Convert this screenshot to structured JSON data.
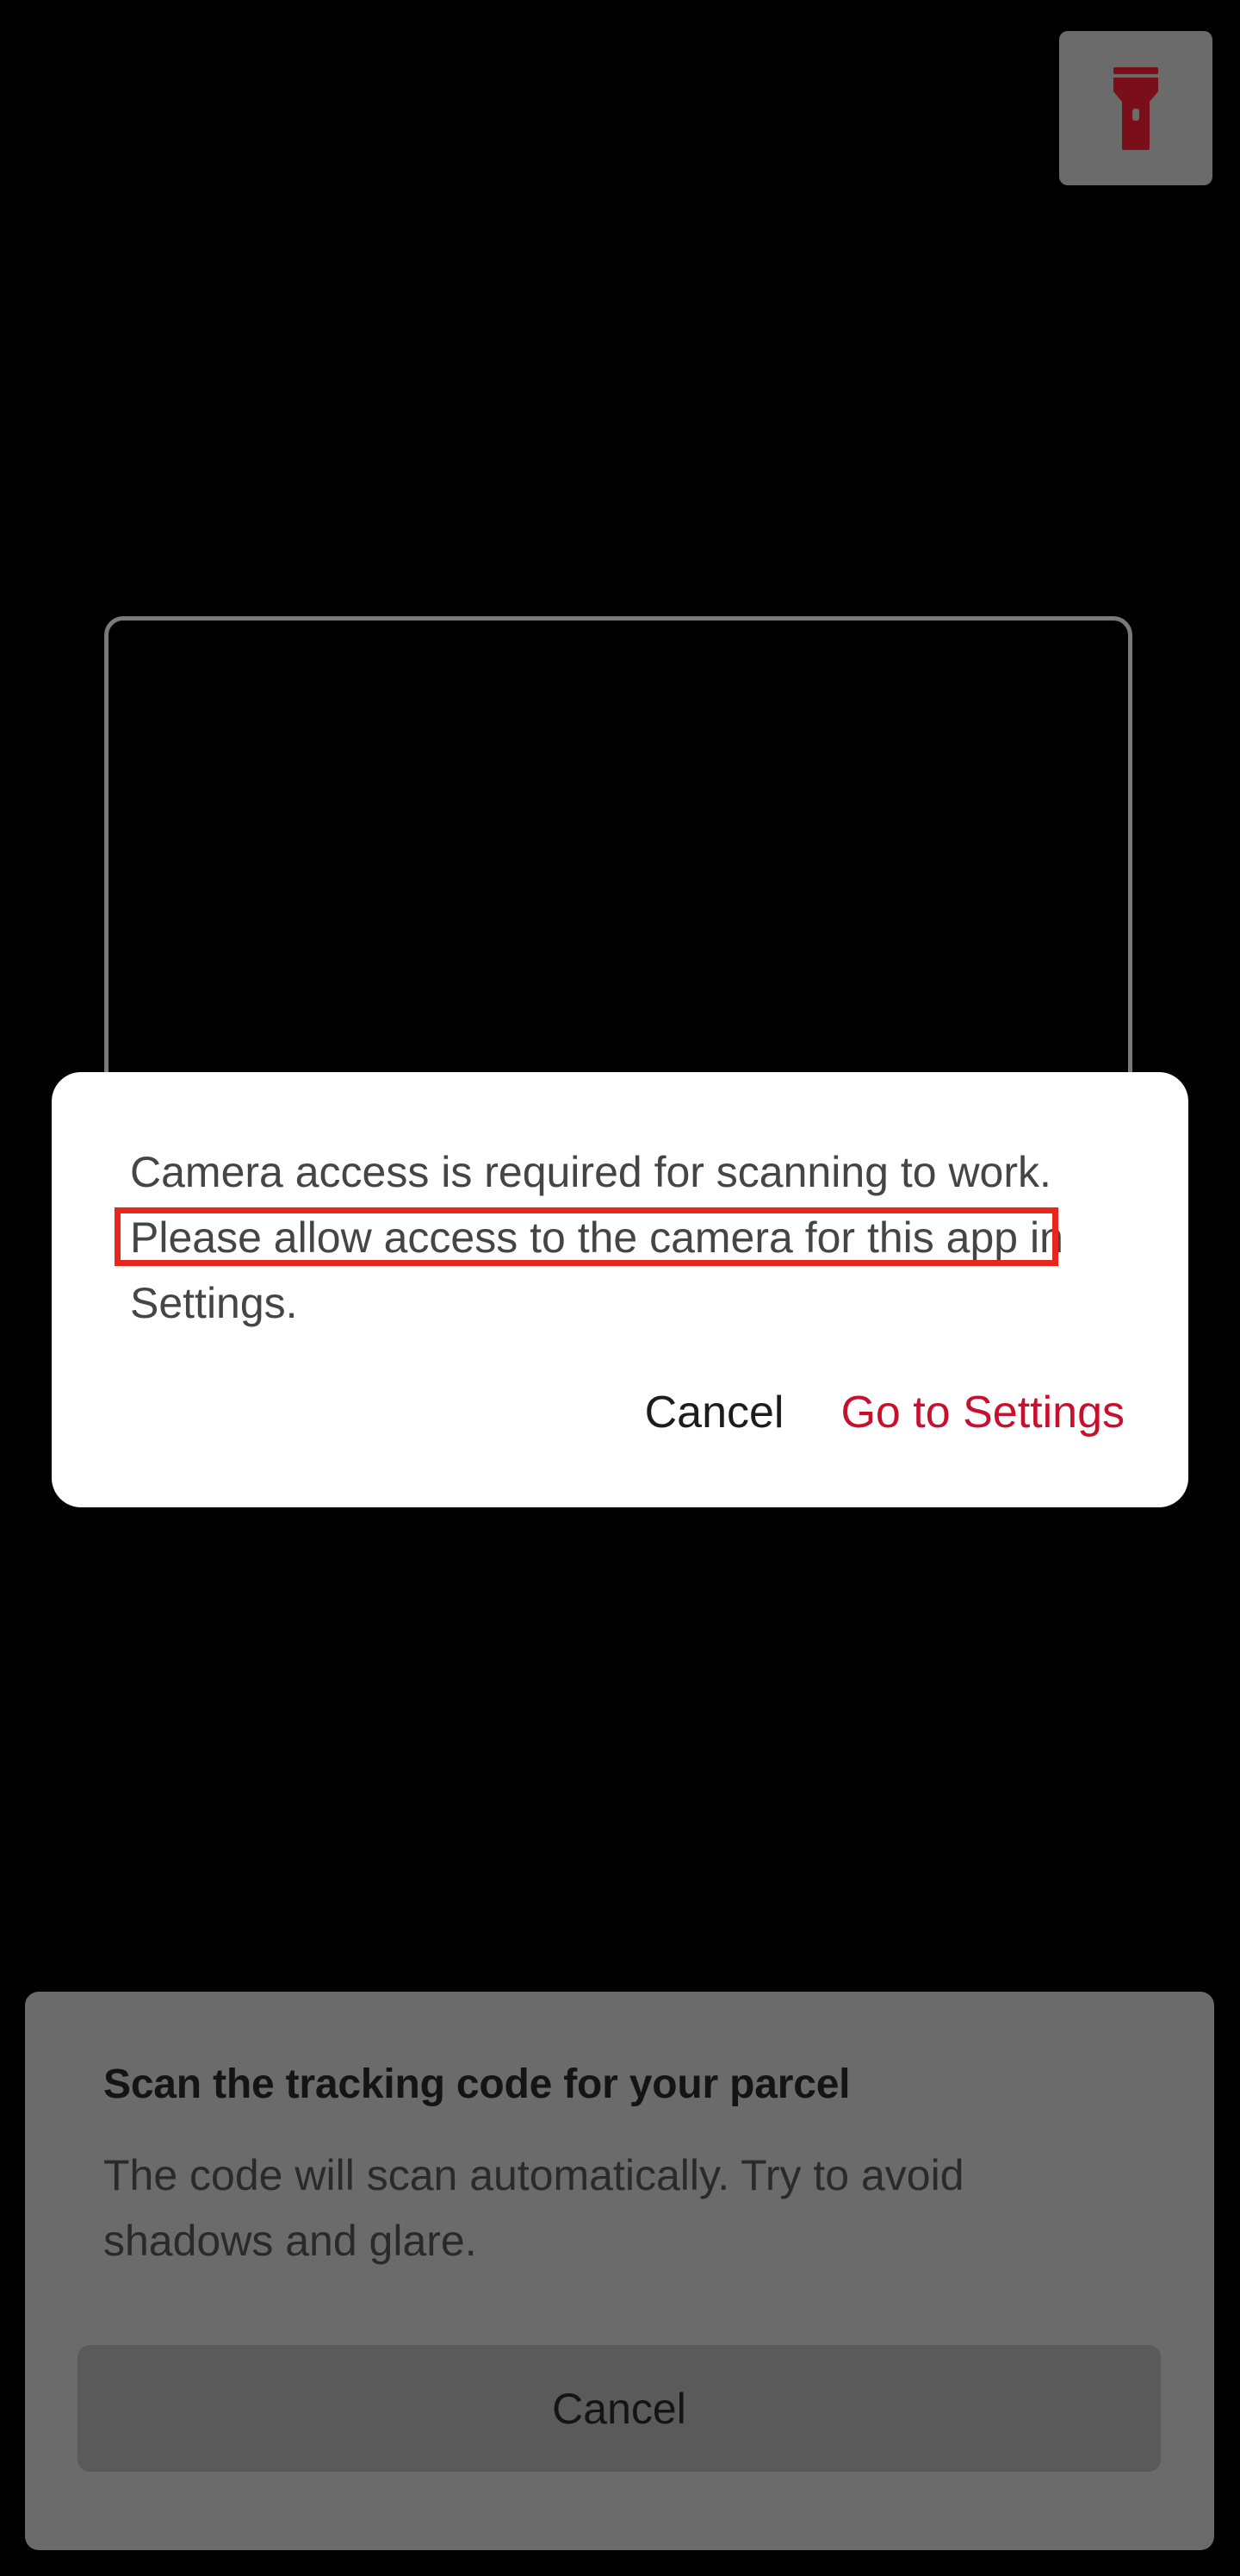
{
  "colors": {
    "background": "#000000",
    "accent": "#c8102e",
    "highlight": "#e8261b",
    "overlay_gray": "#6b6b6b",
    "torch_icon": "#7a0f1a"
  },
  "torch_button": {
    "icon": "flashlight-icon"
  },
  "dialog": {
    "message": "Camera access is required for scanning to work. Please allow access to the camera for this app in Settings.",
    "cancel_label": "Cancel",
    "settings_label": "Go to Settings"
  },
  "bottom_sheet": {
    "title": "Scan the tracking code for your parcel",
    "description": "The code will scan automatically. Try to avoid shadows and glare.",
    "cancel_label": "Cancel"
  }
}
